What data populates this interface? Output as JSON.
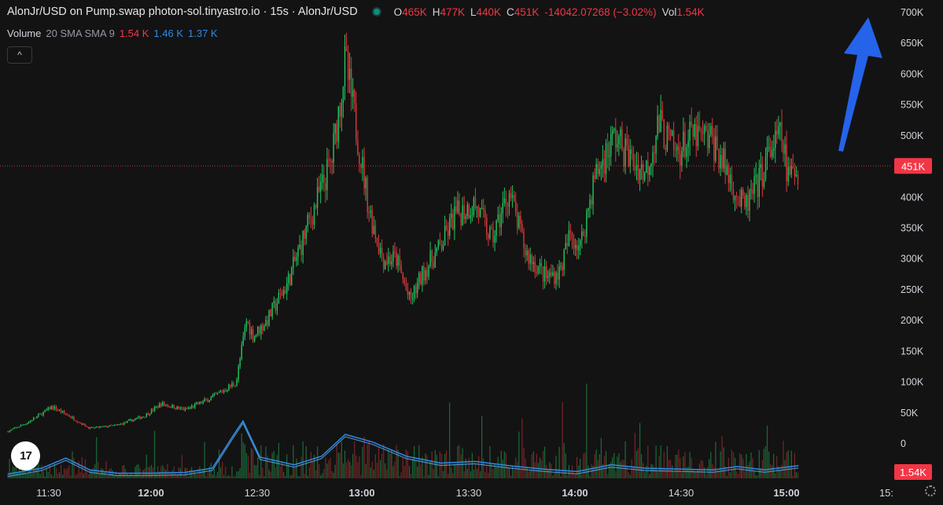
{
  "header": {
    "title": "AlonJr/USD on Pump.swap photon-sol.tinyastro.io · 15s · AlonJr/USD",
    "ohlc": [
      {
        "key": "O",
        "value": "465K"
      },
      {
        "key": "H",
        "value": "477K"
      },
      {
        "key": "L",
        "value": "440K"
      },
      {
        "key": "C",
        "value": "451K"
      }
    ],
    "change": "-14042.07268 (−3.02%)",
    "vol_key": "Vol",
    "vol_value": "1.54K"
  },
  "volume_legend": {
    "label": "Volume",
    "params": "20 SMA SMA 9",
    "values": [
      "1.54 K",
      "1.46 K",
      "1.37 K"
    ]
  },
  "collapse_glyph": "^",
  "logo_text": "17",
  "colors": {
    "up": "#22c55e",
    "down": "#d63a3a",
    "sma": "#2e8ae6",
    "arrow": "#2563eb",
    "price_label": "#f23645"
  },
  "chart_data": {
    "type": "candlestick",
    "price_axis": {
      "ticks": [
        "700K",
        "650K",
        "600K",
        "550K",
        "500K",
        "450K",
        "400K",
        "350K",
        "300K",
        "250K",
        "200K",
        "150K",
        "100K",
        "50K",
        "0"
      ],
      "ylim": [
        0,
        700000
      ]
    },
    "current_price": {
      "value": 451000,
      "label": "451K"
    },
    "current_volume": {
      "value": 1540,
      "label": "1.54K"
    },
    "time_axis": {
      "ticks": [
        "11:30",
        "12:00",
        "12:30",
        "13:00",
        "13:30",
        "14:00",
        "14:30",
        "15:00",
        "15:"
      ],
      "bold": [
        false,
        true,
        false,
        true,
        false,
        true,
        false,
        true,
        false
      ]
    },
    "price_path": [
      [
        "11:18",
        20000
      ],
      [
        "11:24",
        35000
      ],
      [
        "11:31",
        60000
      ],
      [
        "11:36",
        45000
      ],
      [
        "11:42",
        25000
      ],
      [
        "11:50",
        30000
      ],
      [
        "11:58",
        45000
      ],
      [
        "12:03",
        65000
      ],
      [
        "12:10",
        55000
      ],
      [
        "12:18",
        75000
      ],
      [
        "12:25",
        100000
      ],
      [
        "12:28",
        200000
      ],
      [
        "12:30",
        175000
      ],
      [
        "12:34",
        200000
      ],
      [
        "12:40",
        260000
      ],
      [
        "12:47",
        370000
      ],
      [
        "12:53",
        460000
      ],
      [
        "12:57",
        620000
      ],
      [
        "13:00",
        520000
      ],
      [
        "13:04",
        380000
      ],
      [
        "13:08",
        300000
      ],
      [
        "13:12",
        300000
      ],
      [
        "13:16",
        230000
      ],
      [
        "13:20",
        280000
      ],
      [
        "13:25",
        320000
      ],
      [
        "13:29",
        370000
      ],
      [
        "13:35",
        390000
      ],
      [
        "13:40",
        330000
      ],
      [
        "13:45",
        410000
      ],
      [
        "13:50",
        310000
      ],
      [
        "13:56",
        270000
      ],
      [
        "14:00",
        280000
      ],
      [
        "14:03",
        340000
      ],
      [
        "14:06",
        320000
      ],
      [
        "14:10",
        430000
      ],
      [
        "14:16",
        500000
      ],
      [
        "14:21",
        460000
      ],
      [
        "14:25",
        440000
      ],
      [
        "14:29",
        520000
      ],
      [
        "14:34",
        470000
      ],
      [
        "14:39",
        500000
      ],
      [
        "14:45",
        490000
      ],
      [
        "14:50",
        430000
      ],
      [
        "14:54",
        380000
      ],
      [
        "14:58",
        420000
      ],
      [
        "15:02",
        480000
      ],
      [
        "15:05",
        500000
      ],
      [
        "15:07",
        430000
      ],
      [
        "15:10",
        450000
      ]
    ],
    "volume_sma_path": [
      [
        "11:18",
        500
      ],
      [
        "11:28",
        1200
      ],
      [
        "11:35",
        2400
      ],
      [
        "11:42",
        1000
      ],
      [
        "11:50",
        600
      ],
      [
        "12:00",
        600
      ],
      [
        "12:10",
        700
      ],
      [
        "12:18",
        1200
      ],
      [
        "12:24",
        5000
      ],
      [
        "12:27",
        6800
      ],
      [
        "12:32",
        2500
      ],
      [
        "12:42",
        1600
      ],
      [
        "12:50",
        2600
      ],
      [
        "12:57",
        5200
      ],
      [
        "13:05",
        4300
      ],
      [
        "13:15",
        2600
      ],
      [
        "13:25",
        1800
      ],
      [
        "13:35",
        2000
      ],
      [
        "13:45",
        1500
      ],
      [
        "13:55",
        1100
      ],
      [
        "14:05",
        800
      ],
      [
        "14:15",
        1600
      ],
      [
        "14:25",
        1200
      ],
      [
        "14:35",
        1100
      ],
      [
        "14:45",
        1000
      ],
      [
        "14:52",
        1400
      ],
      [
        "15:00",
        1000
      ],
      [
        "15:10",
        1500
      ]
    ]
  }
}
